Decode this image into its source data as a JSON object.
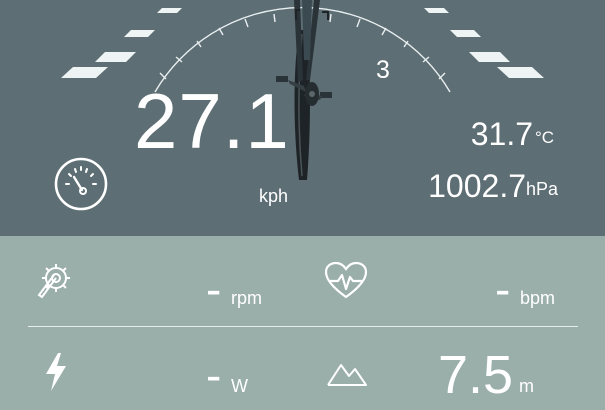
{
  "dashboard": {
    "speed": {
      "value": "27.1",
      "unit": "kph"
    },
    "gear": "3",
    "temperature": {
      "value": "31.7",
      "unit": "°C"
    },
    "pressure": {
      "value": "1002.7",
      "unit": "hPa"
    }
  },
  "metrics": {
    "cadence": {
      "value": "-",
      "unit": "rpm",
      "icon": "cadence-gear-icon"
    },
    "heart_rate": {
      "value": "-",
      "unit": "bpm",
      "icon": "heart-rate-icon"
    },
    "power": {
      "value": "-",
      "unit": "W",
      "icon": "lightning-icon"
    },
    "altitude": {
      "value": "7.5",
      "unit": "m",
      "icon": "mountain-icon"
    }
  },
  "colors": {
    "top_panel": "#5d6e74",
    "bottom_panel": "#9aaeaa",
    "text": "#ffffff"
  }
}
